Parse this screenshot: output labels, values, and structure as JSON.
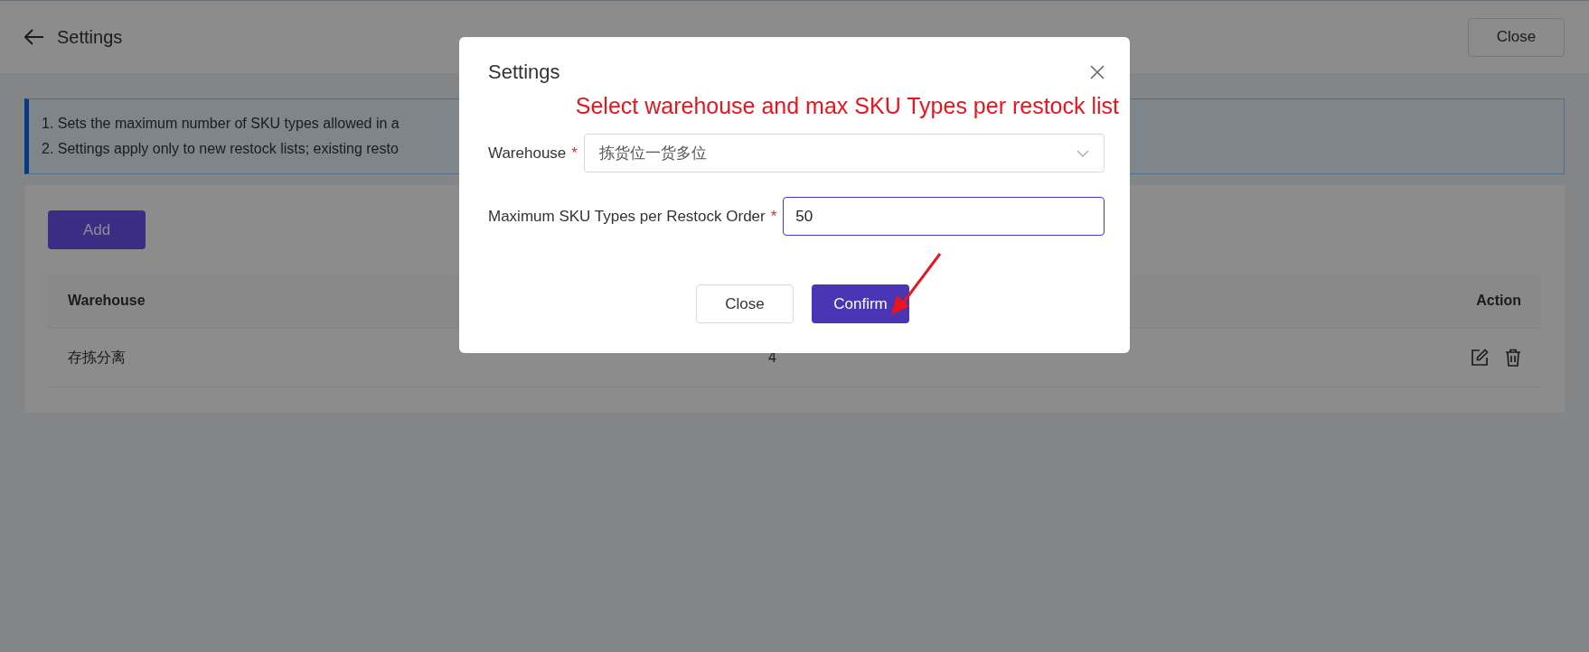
{
  "header": {
    "title": "Settings",
    "close_button": "Close"
  },
  "notice": [
    "1. Sets the maximum number of SKU types allowed in a",
    "2. Settings apply only to new restock lists; existing resto"
  ],
  "add_button": "Add",
  "table": {
    "columns": [
      "Warehouse",
      "Action"
    ],
    "rows": [
      {
        "warehouse": "存拣分离",
        "column_2": "4"
      }
    ]
  },
  "dialog": {
    "title": "Settings",
    "annotation": "Select warehouse and max SKU Types per restock list",
    "fields": [
      {
        "kind": "select",
        "label": "Warehouse",
        "required_mark": "*",
        "value": "拣货位一货多位",
        "focused": false
      },
      {
        "kind": "input",
        "label": "Maximum SKU Types per Restock Order",
        "required_mark": "*",
        "value": "50",
        "focused": true
      }
    ],
    "buttons": [
      {
        "label": "Close",
        "kind": "secondary"
      },
      {
        "label": "Confirm",
        "kind": "primary"
      }
    ]
  }
}
